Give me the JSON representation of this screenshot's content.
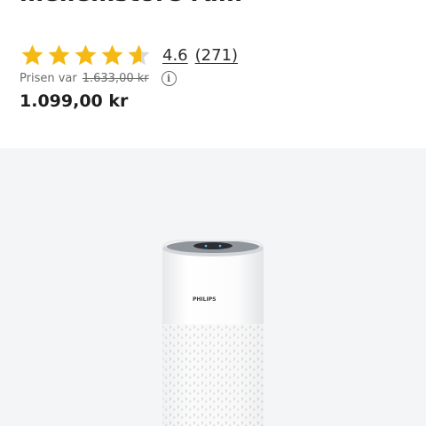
{
  "product": {
    "title_partial": "mellemstore rum",
    "rating_value": "4.6",
    "rating_count": "(271)",
    "rating_fraction": 0.92,
    "prev_price_label": "Prisen var",
    "prev_price": "1.633,00 kr",
    "price": "1.099,00 kr",
    "brand": "PHILIPS",
    "info_icon": "info-icon",
    "star_icon": "star-icon"
  },
  "colors": {
    "star": "#f5b916",
    "star_empty": "#d9d9d9",
    "image_bg": "#f3f5f7"
  }
}
